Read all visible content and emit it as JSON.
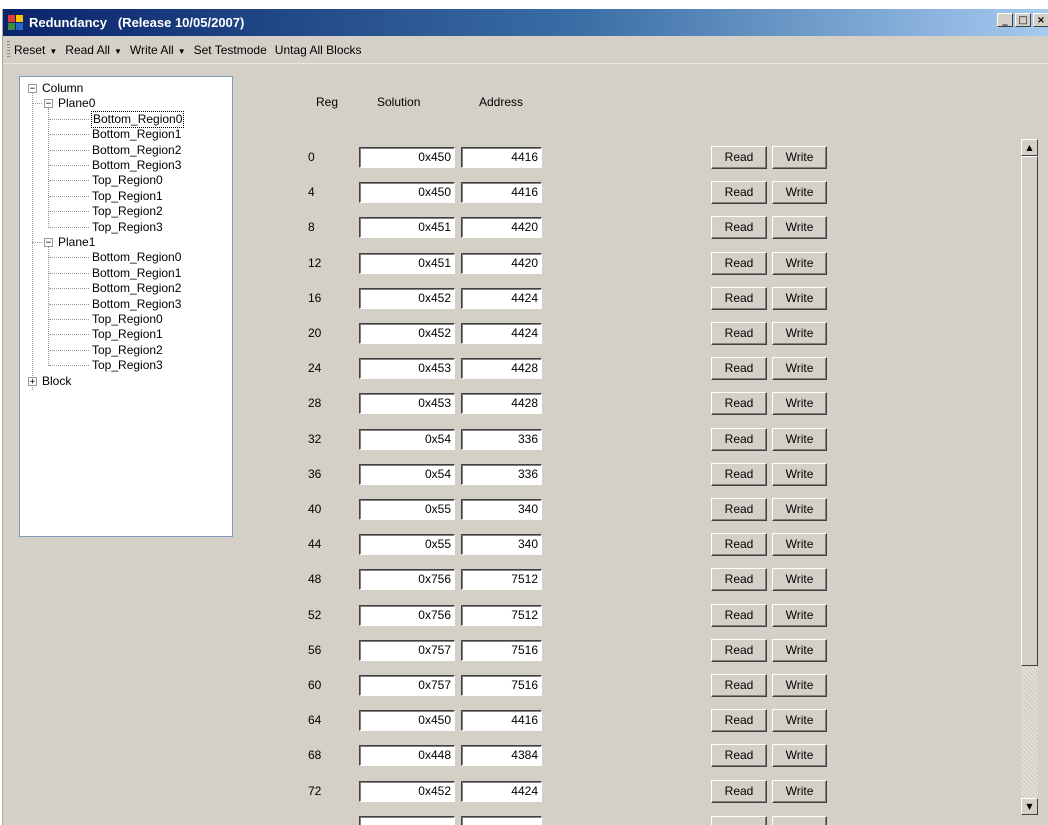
{
  "window": {
    "title": "Redundancy   (Release 10/05/2007)",
    "controls": [
      "_",
      "□",
      "×"
    ]
  },
  "menu": {
    "items": [
      {
        "label": "Reset",
        "dropdown": true
      },
      {
        "label": "Read All",
        "dropdown": true
      },
      {
        "label": "Write All",
        "dropdown": true
      },
      {
        "label": "Set Testmode",
        "dropdown": false
      },
      {
        "label": "Untag All Blocks",
        "dropdown": false
      }
    ]
  },
  "tree": {
    "root": {
      "label": "Column",
      "expanded": true
    },
    "planes": [
      {
        "label": "Plane0",
        "expanded": true,
        "regions": [
          "Bottom_Region0",
          "Bottom_Region1",
          "Bottom_Region2",
          "Bottom_Region3",
          "Top_Region0",
          "Top_Region1",
          "Top_Region2",
          "Top_Region3"
        ]
      },
      {
        "label": "Plane1",
        "expanded": true,
        "regions": [
          "Bottom_Region0",
          "Bottom_Region1",
          "Bottom_Region2",
          "Bottom_Region3",
          "Top_Region0",
          "Top_Region1",
          "Top_Region2",
          "Top_Region3"
        ]
      }
    ],
    "block": {
      "label": "Block",
      "expanded": false
    },
    "selected": "Plane0/Bottom_Region0"
  },
  "table": {
    "headers": {
      "reg": "Reg",
      "solution": "Solution",
      "address": "Address"
    },
    "read_label": "Read",
    "write_label": "Write",
    "rows": [
      {
        "reg": "0",
        "solution": "0x450",
        "address": "4416"
      },
      {
        "reg": "4",
        "solution": "0x450",
        "address": "4416"
      },
      {
        "reg": "8",
        "solution": "0x451",
        "address": "4420"
      },
      {
        "reg": "12",
        "solution": "0x451",
        "address": "4420"
      },
      {
        "reg": "16",
        "solution": "0x452",
        "address": "4424"
      },
      {
        "reg": "20",
        "solution": "0x452",
        "address": "4424"
      },
      {
        "reg": "24",
        "solution": "0x453",
        "address": "4428"
      },
      {
        "reg": "28",
        "solution": "0x453",
        "address": "4428"
      },
      {
        "reg": "32",
        "solution": "0x54",
        "address": "336"
      },
      {
        "reg": "36",
        "solution": "0x54",
        "address": "336"
      },
      {
        "reg": "40",
        "solution": "0x55",
        "address": "340"
      },
      {
        "reg": "44",
        "solution": "0x55",
        "address": "340"
      },
      {
        "reg": "48",
        "solution": "0x756",
        "address": "7512"
      },
      {
        "reg": "52",
        "solution": "0x756",
        "address": "7512"
      },
      {
        "reg": "56",
        "solution": "0x757",
        "address": "7516"
      },
      {
        "reg": "60",
        "solution": "0x757",
        "address": "7516"
      },
      {
        "reg": "64",
        "solution": "0x450",
        "address": "4416"
      },
      {
        "reg": "68",
        "solution": "0x448",
        "address": "4384"
      },
      {
        "reg": "72",
        "solution": "0x452",
        "address": "4424"
      }
    ]
  },
  "scrollbar": {
    "up_icon": "▲",
    "down_icon": "▼"
  }
}
